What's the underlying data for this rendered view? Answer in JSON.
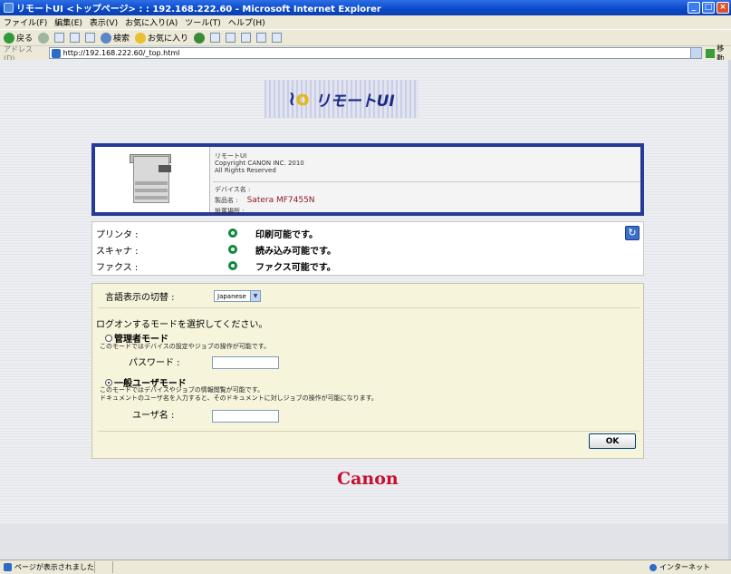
{
  "window": {
    "title": "リモートUI <トップページ> : : 192.168.222.60 - Microsoft Internet Explorer",
    "controls": [
      "_",
      "□",
      "×"
    ]
  },
  "menu": [
    "ファイル(F)",
    "編集(E)",
    "表示(V)",
    "お気に入り(A)",
    "ツール(T)",
    "ヘルプ(H)"
  ],
  "toolbar": {
    "back": "戻る",
    "search": "検索",
    "favorites": "お気に入り"
  },
  "address": {
    "label": "アドレス(D)",
    "url": "http://192.168.222.60/_top.html",
    "go": "移動"
  },
  "header": {
    "app_name": "リモートUI"
  },
  "device_info": {
    "line1": "リモートUI",
    "line2": "Copyright CANON INC. 2010",
    "line3": "All Rights Reserved",
    "device_name_label": "デバイス名 :",
    "product_label": "製品名 :",
    "product_value": "Satera MF7455N",
    "location_label": "設置場所 :"
  },
  "status": {
    "rows": [
      {
        "label": "プリンタ :",
        "message": "印刷可能です。"
      },
      {
        "label": "スキャナ :",
        "message": "読み込み可能です。"
      },
      {
        "label": "ファクス :",
        "message": "ファクス可能です。"
      }
    ],
    "colors": {
      "ready": "#0d8a3a"
    }
  },
  "login": {
    "language_label": "言語表示の切替 :",
    "language_value": "Japanese",
    "prompt": "ログオンするモードを選択してください。",
    "admin_mode": {
      "title": "管理者モード",
      "description": "このモードではデバイスの設定やジョブの操作が可能です。",
      "password_label": "パスワード :",
      "selected": false
    },
    "user_mode": {
      "title": "一般ユーザモード",
      "description1": "このモードではデバイスやジョブの情報閲覧が可能です。",
      "description2": "ドキュメントのユーザ名を入力すると、そのドキュメントに対しジョブの操作が可能になります。",
      "username_label": "ユーザ名 :",
      "selected": true
    },
    "ok_label": "OK"
  },
  "brand": {
    "logo_text": "Canon",
    "color": "#c8102e"
  },
  "statusbar": {
    "text": "ページが表示されました",
    "zone": "インターネット"
  }
}
